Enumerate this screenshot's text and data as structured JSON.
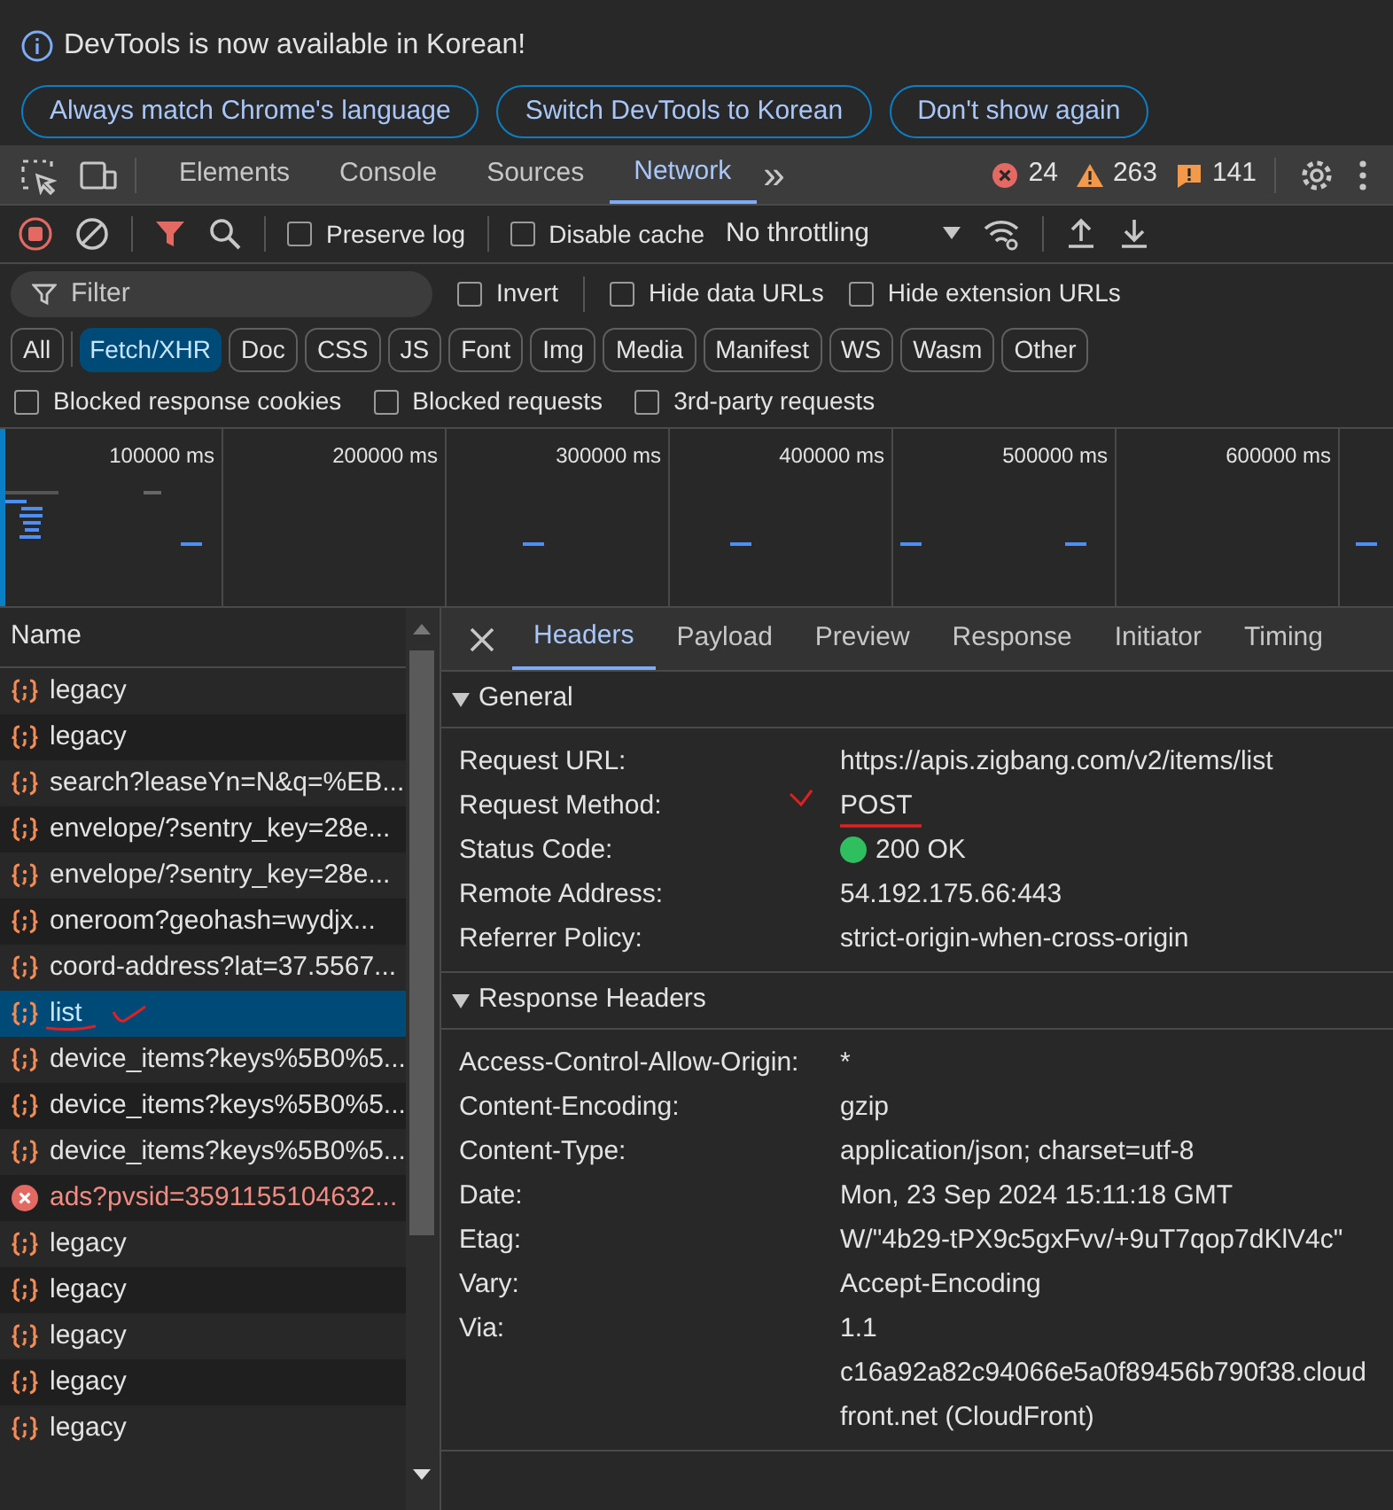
{
  "infobar": {
    "message": "DevTools is now available in Korean!",
    "buttons": [
      "Always match Chrome's language",
      "Switch DevTools to Korean",
      "Don't show again"
    ]
  },
  "tabs": [
    {
      "label": "Elements",
      "selected": false
    },
    {
      "label": "Console",
      "selected": false
    },
    {
      "label": "Sources",
      "selected": false
    },
    {
      "label": "Network",
      "selected": true
    }
  ],
  "more_tabs": "»",
  "counts": [
    {
      "kind": "error",
      "count": "24"
    },
    {
      "kind": "warning",
      "count": "263"
    },
    {
      "kind": "issue",
      "count": "141"
    }
  ],
  "toolbar": {
    "preserve_log": {
      "label": "Preserve log",
      "checked": false
    },
    "disable_cache": {
      "label": "Disable cache",
      "checked": false
    },
    "throttling": "No throttling"
  },
  "filter": {
    "placeholder": "Filter",
    "options": [
      {
        "label": "Invert",
        "checked": false
      },
      {
        "label": "Hide data URLs",
        "checked": false
      },
      {
        "label": "Hide extension URLs",
        "checked": false
      }
    ]
  },
  "types": [
    {
      "label": "All",
      "selected": false
    },
    {
      "label": "Fetch/XHR",
      "selected": true
    },
    {
      "label": "Doc",
      "selected": false
    },
    {
      "label": "CSS",
      "selected": false
    },
    {
      "label": "JS",
      "selected": false
    },
    {
      "label": "Font",
      "selected": false
    },
    {
      "label": "Img",
      "selected": false
    },
    {
      "label": "Media",
      "selected": false
    },
    {
      "label": "Manifest",
      "selected": false
    },
    {
      "label": "WS",
      "selected": false
    },
    {
      "label": "Wasm",
      "selected": false
    },
    {
      "label": "Other",
      "selected": false
    }
  ],
  "blocked": [
    {
      "label": "Blocked response cookies",
      "checked": false
    },
    {
      "label": "Blocked requests",
      "checked": false
    },
    {
      "label": "3rd-party requests",
      "checked": false
    }
  ],
  "timeline": {
    "ticks": [
      "100000 ms",
      "200000 ms",
      "300000 ms",
      "400000 ms",
      "500000 ms",
      "600000 ms"
    ]
  },
  "requests": {
    "column": "Name",
    "rows": [
      {
        "name": "legacy",
        "kind": "xhr",
        "selected": false,
        "marked": false
      },
      {
        "name": "legacy",
        "kind": "xhr",
        "selected": false,
        "marked": false
      },
      {
        "name": "search?leaseYn=N&q=%EB...",
        "kind": "xhr",
        "selected": false,
        "marked": false
      },
      {
        "name": "envelope/?sentry_key=28e...",
        "kind": "xhr",
        "selected": false,
        "marked": false
      },
      {
        "name": "envelope/?sentry_key=28e...",
        "kind": "xhr",
        "selected": false,
        "marked": false
      },
      {
        "name": "oneroom?geohash=wydjx...",
        "kind": "xhr",
        "selected": false,
        "marked": false
      },
      {
        "name": "coord-address?lat=37.5567...",
        "kind": "xhr",
        "selected": false,
        "marked": false
      },
      {
        "name": "list",
        "kind": "xhr",
        "selected": true,
        "marked": true
      },
      {
        "name": "device_items?keys%5B0%5...",
        "kind": "xhr",
        "selected": false,
        "marked": false
      },
      {
        "name": "device_items?keys%5B0%5...",
        "kind": "xhr",
        "selected": false,
        "marked": false
      },
      {
        "name": "device_items?keys%5B0%5...",
        "kind": "xhr",
        "selected": false,
        "marked": false
      },
      {
        "name": "ads?pvsid=3591155104632...",
        "kind": "error",
        "selected": false,
        "marked": false
      },
      {
        "name": "legacy",
        "kind": "xhr",
        "selected": false,
        "marked": false
      },
      {
        "name": "legacy",
        "kind": "xhr",
        "selected": false,
        "marked": false
      },
      {
        "name": "legacy",
        "kind": "xhr",
        "selected": false,
        "marked": false
      },
      {
        "name": "legacy",
        "kind": "xhr",
        "selected": false,
        "marked": false
      },
      {
        "name": "legacy",
        "kind": "xhr",
        "selected": false,
        "marked": false
      }
    ]
  },
  "detail_tabs": [
    {
      "label": "Headers",
      "selected": true
    },
    {
      "label": "Payload",
      "selected": false
    },
    {
      "label": "Preview",
      "selected": false
    },
    {
      "label": "Response",
      "selected": false
    },
    {
      "label": "Initiator",
      "selected": false
    },
    {
      "label": "Timing",
      "selected": false
    }
  ],
  "general": {
    "title": "General",
    "expanded": true,
    "rows": [
      {
        "name": "Request URL:",
        "value": "https://apis.zigbang.com/v2/items/list",
        "marked": false
      },
      {
        "name": "Request Method:",
        "value": "POST",
        "marked": true
      },
      {
        "name": "Status Code:",
        "value": "200 OK",
        "color": "#2fbf5f",
        "marked": false
      },
      {
        "name": "Remote Address:",
        "value": "54.192.175.66:443",
        "marked": false
      },
      {
        "name": "Referrer Policy:",
        "value": "strict-origin-when-cross-origin",
        "marked": false
      }
    ]
  },
  "response_headers": {
    "title": "Response Headers",
    "expanded": true,
    "rows": [
      {
        "name": "Access-Control-Allow-Origin:",
        "value": "*"
      },
      {
        "name": "Content-Encoding:",
        "value": "gzip"
      },
      {
        "name": "Content-Type:",
        "value": "application/json; charset=utf-8"
      },
      {
        "name": "Date:",
        "value": "Mon, 23 Sep 2024 15:11:18 GMT"
      },
      {
        "name": "Etag:",
        "value": "W/\"4b29-tPX9c5gxFvv/+9uT7qop7dKlV4c\""
      },
      {
        "name": "Vary:",
        "value": "Accept-Encoding"
      },
      {
        "name": "Via:",
        "value": "1.1 c16a92a82c94066e5a0f89456b790f38.cloudfront.net (CloudFront)"
      }
    ]
  }
}
